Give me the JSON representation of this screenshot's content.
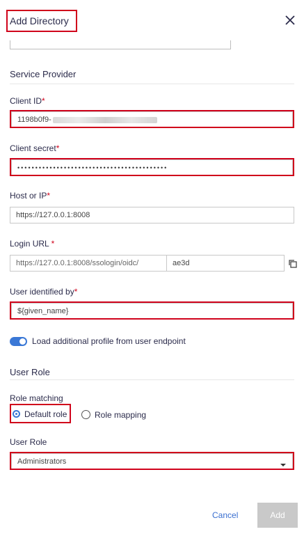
{
  "dialog": {
    "title": "Add Directory",
    "close_icon": "close-icon"
  },
  "service_provider": {
    "heading": "Service Provider",
    "client_id": {
      "label": "Client ID",
      "required": "*",
      "value": "1198b0f9-"
    },
    "client_secret": {
      "label": "Client secret",
      "required": "*",
      "value": "••••••••••••••••••••••••••••••••••••••••••"
    },
    "host": {
      "label": "Host or IP",
      "required": "*",
      "value": "https://127.0.0.1:8008"
    },
    "login_url": {
      "label": "Login URL",
      "required": " *",
      "prefix": "https://127.0.0.1:8008/ssologin/oidc/",
      "value": "ae3d",
      "copy_icon": "copy-icon"
    },
    "user_identified_by": {
      "label": "User identified by",
      "required": "*",
      "value": "${given_name}"
    },
    "load_profile_toggle": {
      "label": "Load additional profile from user endpoint",
      "on": true
    }
  },
  "user_role_section": {
    "heading": "User Role",
    "role_matching": {
      "label": "Role matching",
      "options": [
        "Default role",
        "Role mapping"
      ],
      "selected": "Default role"
    },
    "user_role": {
      "label": "User Role",
      "value": "Administrators",
      "dropdown_icon": "caret-down-icon"
    }
  },
  "footer": {
    "cancel_label": "Cancel",
    "add_label": "Add"
  },
  "colors": {
    "accent": "#3a78d6",
    "required": "#d0021b",
    "highlight_border": "#d0021b",
    "disabled_button": "#c9c9c9"
  }
}
